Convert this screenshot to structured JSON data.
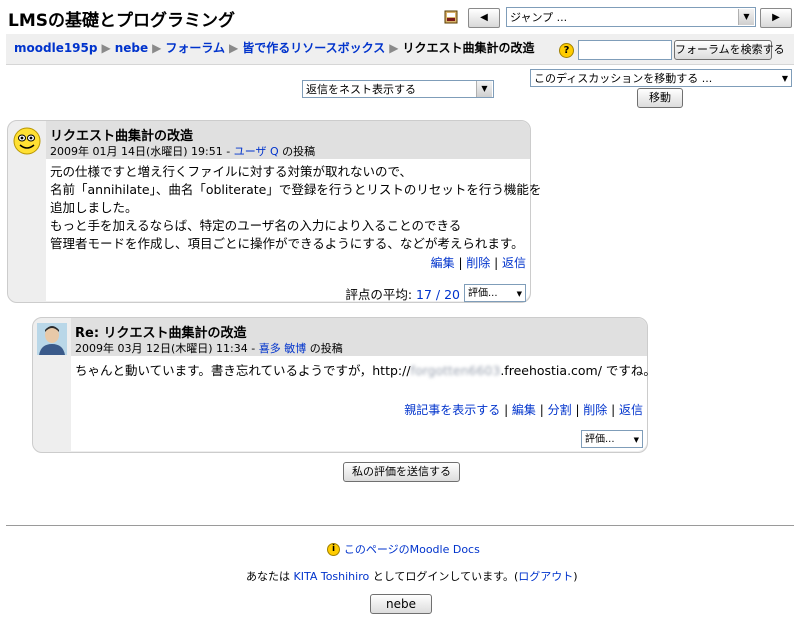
{
  "header": {
    "title": "LMSの基礎とプログラミング",
    "jump_label": "ジャンプ ...",
    "prev_symbol": "◀",
    "next_symbol": "▶"
  },
  "breadcrumb": {
    "items": [
      "moodle195p",
      "nebe",
      "フォーラム",
      "皆で作るリソースボックス"
    ],
    "current": "リクエスト曲集計の改造",
    "separator": "▶"
  },
  "search": {
    "button_label": "フォーラムを検索する",
    "help_symbol": "?"
  },
  "controls": {
    "display_mode": "返信をネスト表示する",
    "move_select": "このディスカッションを移動する ...",
    "move_button": "移動"
  },
  "posts": [
    {
      "subject": "リクエスト曲集計の改造",
      "date": "2009年 01月 14日(水曜日) 19:51 - ",
      "author": "ユーザ Q",
      "suffix": " の投稿",
      "content": [
        "元の仕様ですと増え行くファイルに対する対策が取れないので、",
        "名前「annihilate」、曲名「obliterate」で登録を行うとリストのリセットを行う機能を",
        "追加しました。",
        "もっと手を加えるならば、特定のユーザ名の入力により入ることのできる",
        "管理者モードを作成し、項目ごとに操作ができるようにする、などが考えられます。"
      ],
      "commands": [
        "編集",
        "削除",
        "返信"
      ],
      "rating_label": "評点の平均: ",
      "rating_value": "17 / 20",
      "rate_select": "評価..."
    },
    {
      "subject": "Re: リクエスト曲集計の改造",
      "date": "2009年 03月 12日(木曜日) 11:34 - ",
      "author": "喜多 敏博",
      "suffix": " の投稿",
      "content_prefix": "ちゃんと動いています。書き忘れているようですが，http://",
      "content_blurred": "forgotten6603",
      "content_suffix": ".freehostia.com/ ですね。",
      "commands": [
        "親記事を表示する",
        "編集",
        "分割",
        "削除",
        "返信"
      ],
      "rate_select": "評価..."
    }
  ],
  "submit_ratings": "私の評価を送信する",
  "footer": {
    "docs_link": "このページのMoodle Docs",
    "login_prefix": "あなたは ",
    "login_user": "KITA Toshihiro",
    "login_middle": " としてログインしています。(",
    "logout": "ログアウト",
    "login_end": ")",
    "course_button": "nebe"
  },
  "colors": {
    "link": "#0033cc",
    "post_header": "#e0e0e0",
    "post_border": "#cccccc"
  }
}
